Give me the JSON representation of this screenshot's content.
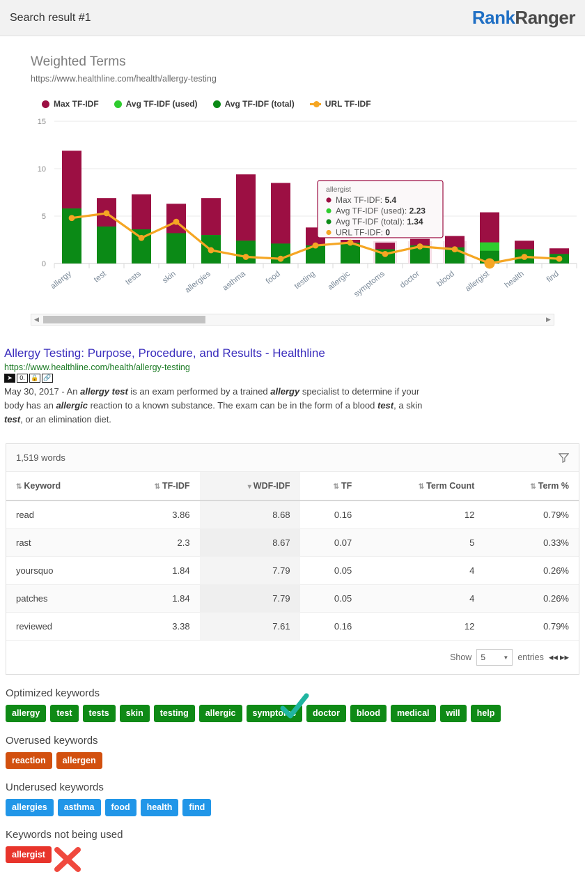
{
  "topbar": {
    "title": "Search result #1",
    "logo_rank": "Rank",
    "logo_ranger": "Ranger"
  },
  "chart_panel": {
    "title": "Weighted Terms",
    "url": "https://www.healthline.com/health/allergy-testing"
  },
  "chart_data": {
    "type": "bar",
    "title": "Weighted Terms",
    "subtitle": "https://www.healthline.com/health/allergy-testing",
    "xlabel": "",
    "ylabel": "",
    "ylim": [
      0,
      15
    ],
    "yticks": [
      0,
      5,
      10,
      15
    ],
    "grid": true,
    "legend_position": "top-left",
    "stacked": true,
    "categories": [
      "allergy",
      "test",
      "tests",
      "skin",
      "allergies",
      "asthma",
      "food",
      "testing",
      "allergic",
      "symptoms",
      "doctor",
      "blood",
      "allergist",
      "health",
      "find"
    ],
    "series": [
      {
        "name": "Max TF-IDF",
        "color": "#9c0f43",
        "type": "bar",
        "values": [
          11.9,
          6.9,
          7.3,
          6.3,
          6.9,
          9.4,
          8.5,
          3.8,
          2.5,
          2.2,
          2.6,
          2.9,
          5.4,
          2.4,
          1.6
        ]
      },
      {
        "name": "Avg TF-IDF (used)",
        "color": "#2ecc2e",
        "type": "bar",
        "values": [
          5.8,
          3.9,
          3.6,
          3.2,
          3.0,
          2.4,
          2.1,
          1.9,
          2.2,
          1.5,
          1.9,
          1.7,
          2.23,
          1.5,
          1.0
        ]
      },
      {
        "name": "Avg TF-IDF (total)",
        "color": "#0b8a16",
        "type": "bar",
        "values": [
          5.8,
          3.9,
          3.6,
          3.2,
          3.0,
          2.4,
          2.1,
          1.9,
          2.2,
          1.5,
          1.9,
          1.7,
          1.34,
          1.5,
          1.0
        ]
      },
      {
        "name": "URL TF-IDF",
        "color": "#f5a623",
        "type": "line",
        "values": [
          4.8,
          5.3,
          2.7,
          4.4,
          1.4,
          0.7,
          0.5,
          1.9,
          2.2,
          1.0,
          1.8,
          1.5,
          0,
          0.7,
          0.5
        ]
      }
    ],
    "tooltip": {
      "label": "allergist",
      "rows": [
        {
          "name": "Max TF-IDF",
          "value": "5.4",
          "color": "#9c0f43"
        },
        {
          "name": "Avg TF-IDF (used)",
          "value": "2.23",
          "color": "#2ecc2e"
        },
        {
          "name": "Avg TF-IDF (total)",
          "value": "1.34",
          "color": "#0b8a16"
        },
        {
          "name": "URL TF-IDF",
          "value": "0",
          "color": "#f5a623"
        }
      ]
    }
  },
  "result": {
    "title": "Allergy Testing: Purpose, Procedure, and Results - Healthline",
    "url": "https://www.healthline.com/health/allergy-testing",
    "icons": [
      "arrow-icon",
      "zero-icon",
      "lock-icon",
      "link-icon"
    ],
    "snippet_prefix": "May 30, 2017 - An ",
    "snippet_parts": [
      {
        "t": "May 30, 2017 - An ",
        "b": false
      },
      {
        "t": "allergy test",
        "b": true
      },
      {
        "t": " is an exam performed by a trained ",
        "b": false
      },
      {
        "t": "allergy",
        "b": true
      },
      {
        "t": " specialist to determine if your body has an ",
        "b": false
      },
      {
        "t": "allergic",
        "b": true
      },
      {
        "t": " reaction to a known substance. The exam can be in the form of a blood ",
        "b": false
      },
      {
        "t": "test",
        "b": true
      },
      {
        "t": ", a skin ",
        "b": false
      },
      {
        "t": "test",
        "b": true
      },
      {
        "t": ", or an elimination diet.",
        "b": false
      }
    ]
  },
  "table": {
    "word_count": "1,519 words",
    "filter_icon": "funnel-icon",
    "columns": [
      {
        "label": "Keyword",
        "align": "left",
        "sort": "both"
      },
      {
        "label": "TF-IDF",
        "align": "right",
        "sort": "both"
      },
      {
        "label": "WDF-IDF",
        "align": "right",
        "sort": "desc"
      },
      {
        "label": "TF",
        "align": "right",
        "sort": "both"
      },
      {
        "label": "Term Count",
        "align": "right",
        "sort": "both"
      },
      {
        "label": "Term %",
        "align": "right",
        "sort": "both"
      }
    ],
    "rows": [
      {
        "keyword": "read",
        "tfidf": "3.86",
        "wdfidf": "8.68",
        "tf": "0.16",
        "count": "12",
        "pct": "0.79%"
      },
      {
        "keyword": "rast",
        "tfidf": "2.3",
        "wdfidf": "8.67",
        "tf": "0.07",
        "count": "5",
        "pct": "0.33%"
      },
      {
        "keyword": "yoursquo",
        "tfidf": "1.84",
        "wdfidf": "7.79",
        "tf": "0.05",
        "count": "4",
        "pct": "0.26%"
      },
      {
        "keyword": "patches",
        "tfidf": "1.84",
        "wdfidf": "7.79",
        "tf": "0.05",
        "count": "4",
        "pct": "0.26%"
      },
      {
        "keyword": "reviewed",
        "tfidf": "3.38",
        "wdfidf": "7.61",
        "tf": "0.16",
        "count": "12",
        "pct": "0.79%"
      }
    ],
    "footer": {
      "show_label": "Show",
      "entries_value": "5",
      "entries_label": "entries",
      "prev_icon": "double-chevron-left-icon",
      "next_icon": "double-chevron-right-icon"
    }
  },
  "keyword_groups": [
    {
      "heading": "Optimized keywords",
      "style": "green",
      "marker": "check",
      "chips": [
        "allergy",
        "test",
        "tests",
        "skin",
        "testing",
        "allergic",
        "symptoms",
        "doctor",
        "blood",
        "medical",
        "will",
        "help"
      ]
    },
    {
      "heading": "Overused keywords",
      "style": "orange",
      "marker": "none",
      "chips": [
        "reaction",
        "allergen"
      ]
    },
    {
      "heading": "Underused keywords",
      "style": "blue",
      "marker": "none",
      "chips": [
        "allergies",
        "asthma",
        "food",
        "health",
        "find"
      ]
    },
    {
      "heading": "Keywords not being used",
      "style": "red",
      "marker": "cross",
      "chips": [
        "allergist"
      ]
    }
  ],
  "colors": {
    "max_tfidf": "#9c0f43",
    "avg_used": "#2ecc2e",
    "avg_total": "#0b8a16",
    "url_tfidf": "#f5a623",
    "brand_blue": "#1f6fc4",
    "link_blue": "#3b2ebd",
    "url_green": "#1a7a23",
    "check_teal": "#1fb5a0",
    "cross_red": "#f0493e"
  }
}
